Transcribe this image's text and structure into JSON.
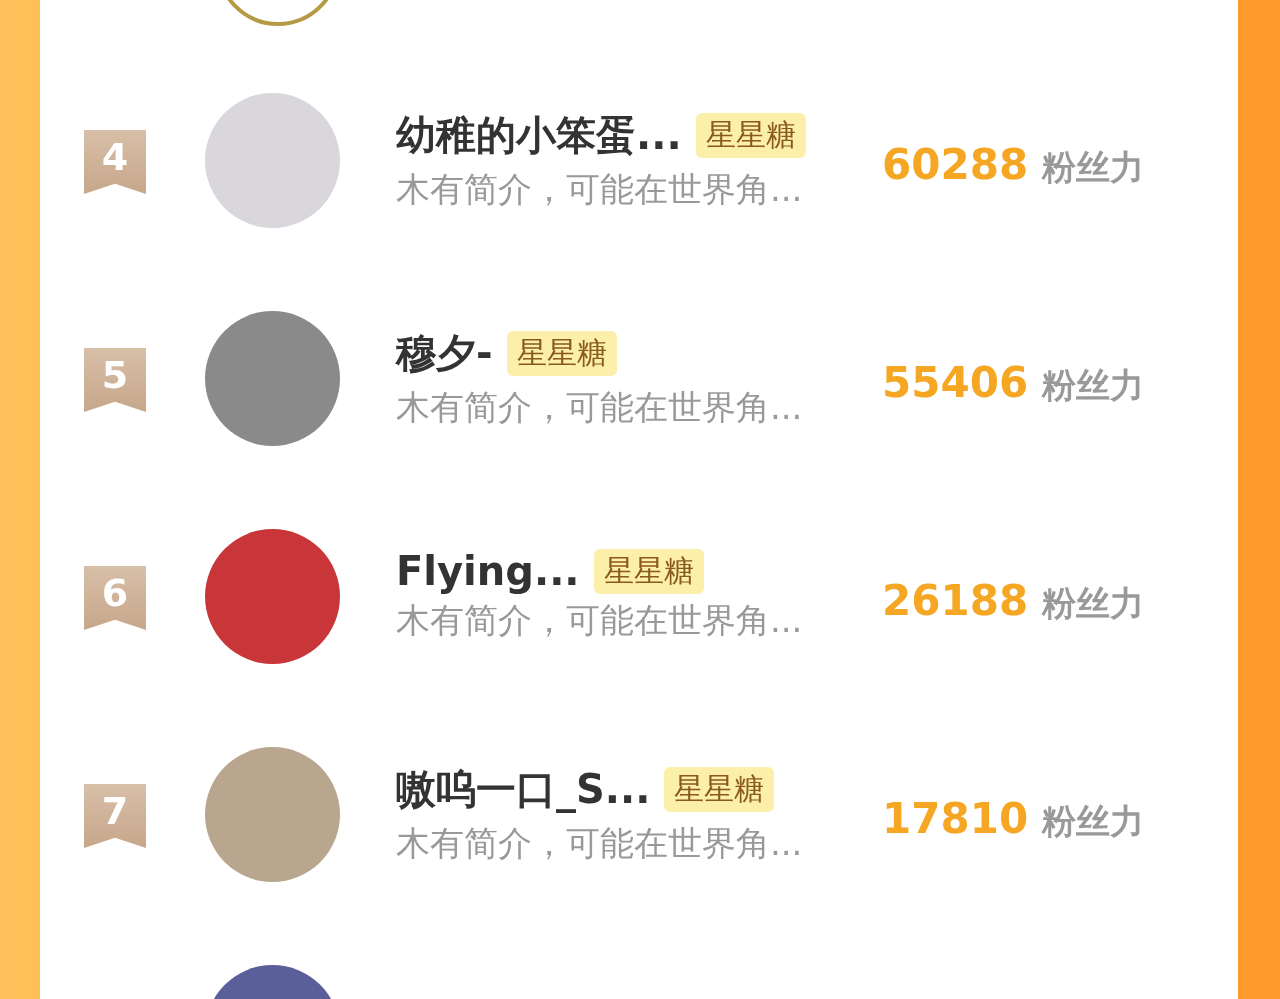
{
  "ranking": [
    {
      "rank": "4",
      "name": "幼稚的小笨蛋...",
      "badge": "星星糖",
      "bio": "木有简介，可能在世界角...",
      "score": "60288",
      "score_unit": "粉丝力"
    },
    {
      "rank": "5",
      "name": "穆夕-",
      "badge": "星星糖",
      "bio": "木有简介，可能在世界角...",
      "score": "55406",
      "score_unit": "粉丝力"
    },
    {
      "rank": "6",
      "name": "Flying...",
      "badge": "星星糖",
      "bio": "木有简介，可能在世界角...",
      "score": "26188",
      "score_unit": "粉丝力"
    },
    {
      "rank": "7",
      "name": "嗷呜一口_S...",
      "badge": "星星糖",
      "bio": "木有简介，可能在世界角...",
      "score": "17810",
      "score_unit": "粉丝力"
    }
  ]
}
